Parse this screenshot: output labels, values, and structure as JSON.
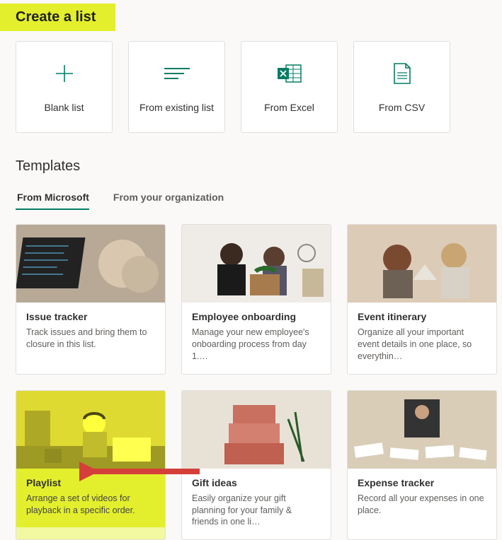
{
  "title": "Create a list",
  "create_options": [
    {
      "id": "blank",
      "label": "Blank list",
      "icon": "plus-icon"
    },
    {
      "id": "existing",
      "label": "From existing list",
      "icon": "list-icon"
    },
    {
      "id": "excel",
      "label": "From Excel",
      "icon": "excel-icon"
    },
    {
      "id": "csv",
      "label": "From CSV",
      "icon": "csv-icon"
    }
  ],
  "templates_heading": "Templates",
  "tabs": {
    "microsoft": "From Microsoft",
    "organization": "From your organization",
    "active": "microsoft"
  },
  "templates": [
    {
      "id": "issue-tracker",
      "name": "Issue tracker",
      "desc": "Track issues and bring them to closure in this list."
    },
    {
      "id": "employee-onboarding",
      "name": "Employee onboarding",
      "desc": "Manage your new employee's onboarding process from day 1.…"
    },
    {
      "id": "event-itinerary",
      "name": "Event itinerary",
      "desc": "Organize all your important event details in one place, so everythin…"
    },
    {
      "id": "playlist",
      "name": "Playlist",
      "desc": "Arrange a set of videos for playback in a specific order.",
      "highlighted": true
    },
    {
      "id": "gift-ideas",
      "name": "Gift ideas",
      "desc": "Easily organize your gift planning for your family & friends in one li…"
    },
    {
      "id": "expense-tracker",
      "name": "Expense tracker",
      "desc": "Record all your expenses in one place."
    }
  ],
  "arrow": {
    "points_to": "playlist",
    "color": "#d43f3a"
  }
}
